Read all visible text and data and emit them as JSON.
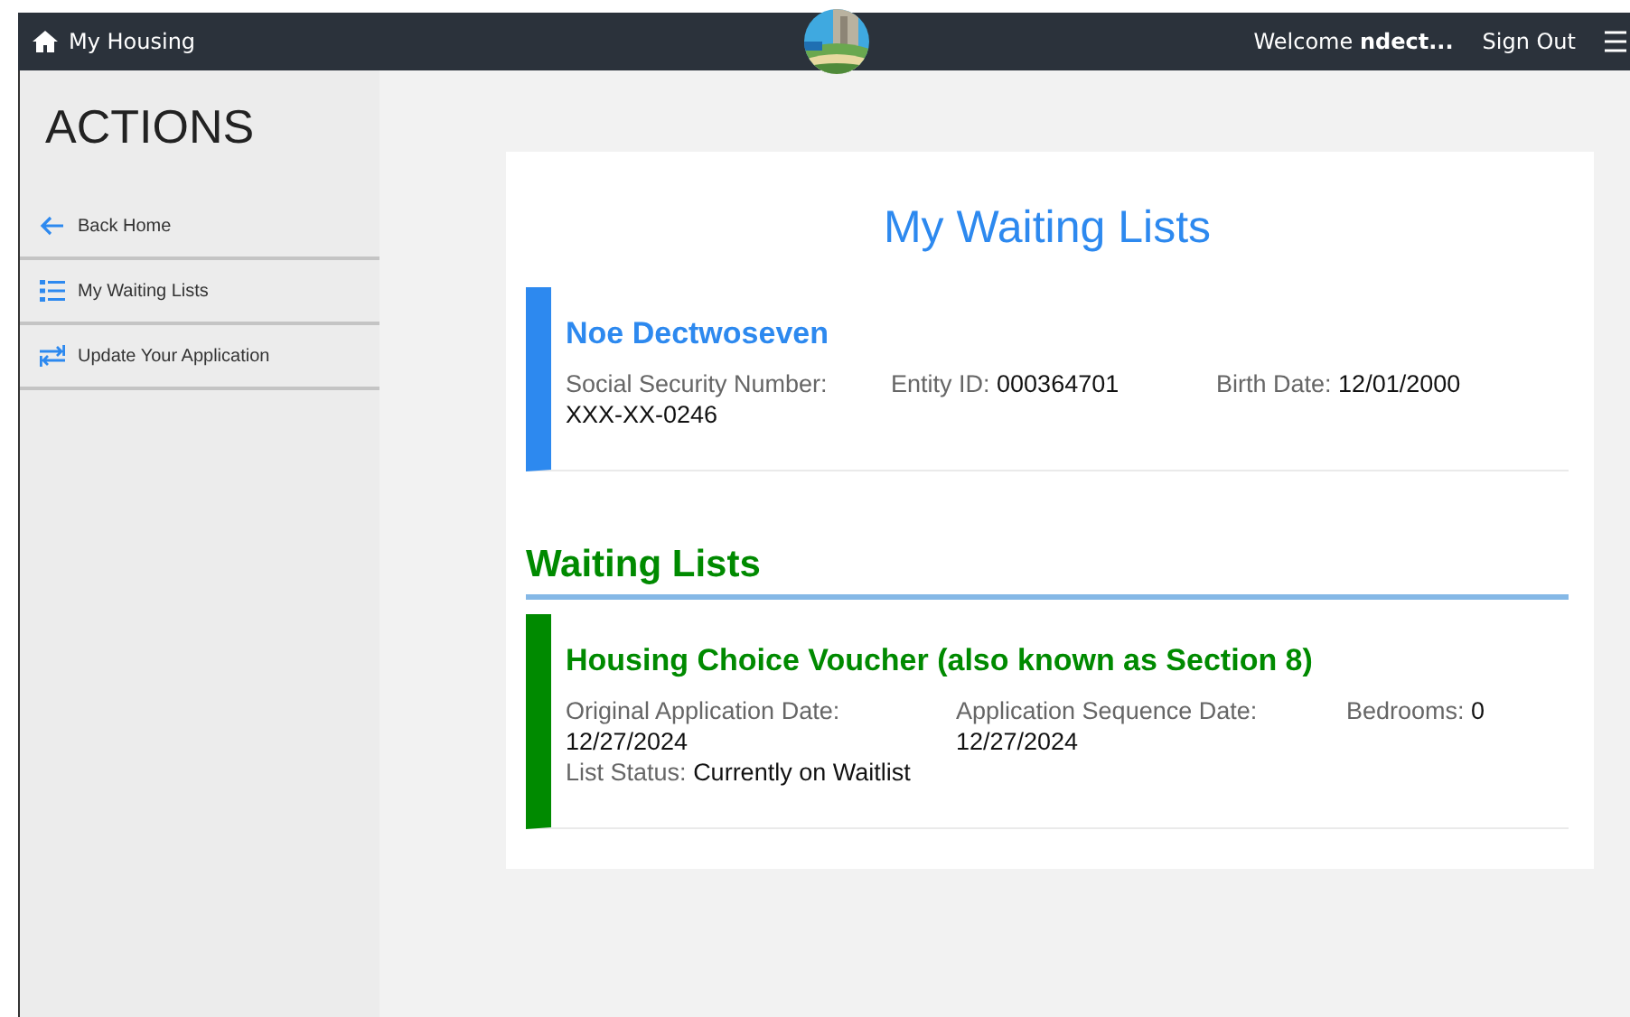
{
  "topbar": {
    "title": "My Housing",
    "welcome": "Welcome",
    "user": "ndect...",
    "sign_out": "Sign Out"
  },
  "sidebar": {
    "heading": "ACTIONS",
    "items": [
      {
        "label": "Back Home",
        "kind": "back"
      },
      {
        "label": "My Waiting Lists",
        "kind": "list"
      },
      {
        "label": "Update Your Application",
        "kind": "update"
      }
    ]
  },
  "page_title": "My Waiting Lists",
  "person": {
    "name": "Noe Dectwoseven",
    "fields": [
      {
        "label": "Social Security Number:",
        "value": "XXX-XX-0246"
      },
      {
        "label": "Entity ID:",
        "value": "000364701"
      },
      {
        "label": "Birth Date:",
        "value": "12/01/2000"
      }
    ]
  },
  "waiting_lists": {
    "heading": "Waiting Lists",
    "items": [
      {
        "title": "Housing Choice Voucher (also known as Section 8)",
        "fields": [
          {
            "label": "Original Application Date:",
            "value": "12/27/2024"
          },
          {
            "label": "Application Sequence Date:",
            "value": "12/27/2024"
          },
          {
            "label": "Bedrooms:",
            "value": "0"
          },
          {
            "label": "List Status:",
            "value": "Currently on Waitlist"
          }
        ]
      }
    ]
  }
}
